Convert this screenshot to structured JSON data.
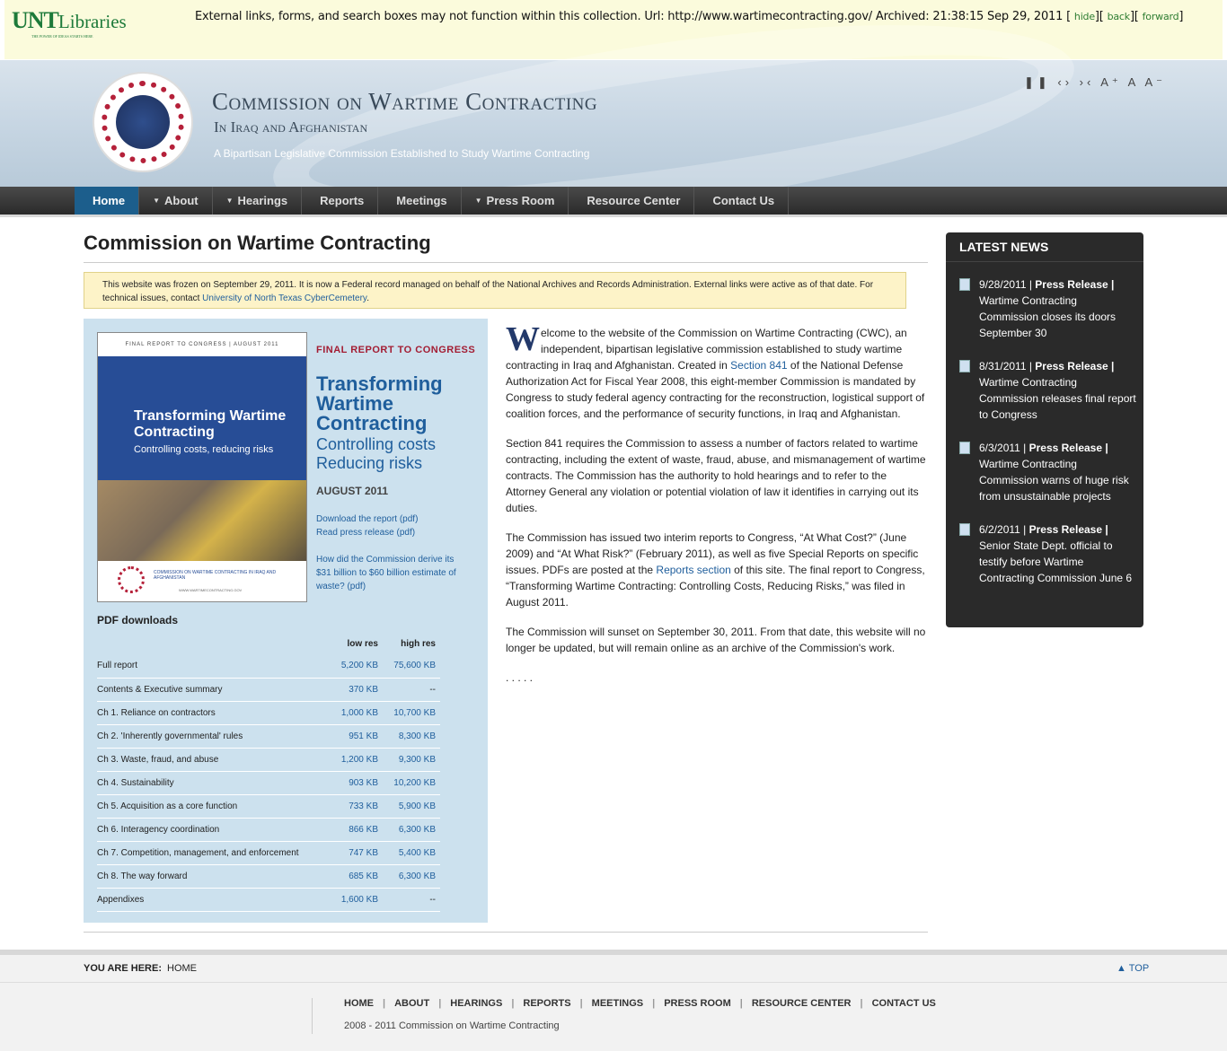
{
  "unt": {
    "logo_unt": "UNT",
    "logo_libraries": "Libraries",
    "logo_tagline": "THE POWER OF IDEAS STARTS HERE",
    "message": "External links, forms, and search boxes may not function within this collection. Url: http://www.wartimecontracting.gov/ Archived: 21:38:15 Sep 29, 2011 [",
    "hide": "hide",
    "sep1": "][",
    "back": "back",
    "sep2": "][",
    "forward": "forward",
    "end": "]"
  },
  "header": {
    "title": "Commission on Wartime Contracting",
    "subtitle": "In Iraq and Afghanistan",
    "tagline": "A Bipartisan Legislative Commission Established to Study Wartime Contracting",
    "tools": "❚❚ ‹› ›‹  A⁺ A A⁻"
  },
  "nav": [
    {
      "label": "Home",
      "caret": ""
    },
    {
      "label": "About",
      "caret": "▼"
    },
    {
      "label": "Hearings",
      "caret": "▼"
    },
    {
      "label": "Reports",
      "caret": ""
    },
    {
      "label": "Meetings",
      "caret": ""
    },
    {
      "label": "Press Room",
      "caret": "▼"
    },
    {
      "label": "Resource Center",
      "caret": ""
    },
    {
      "label": "Contact Us",
      "caret": ""
    }
  ],
  "page": {
    "title": "Commission on Wartime Contracting",
    "notice_text": "This website was frozen on September 29, 2011. It is now a Federal record managed on behalf of the National Archives and Records Administration. External links were active as of that date. For technical issues, contact ",
    "notice_link": "University of North Texas CyberCemetery",
    "notice_end": "."
  },
  "report": {
    "cover_top": "FINAL REPORT TO CONGRESS  |  AUGUST 2011",
    "cover_title": "Transforming Wartime Contracting",
    "cover_sub": "Controlling costs, reducing risks",
    "cover_footer": "COMMISSION ON WARTIME CONTRACTING IN IRAQ AND AFGHANISTAN",
    "cover_url": "WWW.WARTIMECONTRACTING.GOV",
    "label": "FINAL REPORT TO CONGRESS",
    "title": "Transforming Wartime Contracting",
    "subtitle_1": "Controlling costs",
    "subtitle_2": "Reducing risks",
    "date": "AUGUST 2011",
    "link_download": "Download the report (pdf)",
    "link_press": "Read press release (pdf)",
    "link_estimate": "How did the Commission derive its $31 billion to $60 billion estimate of waste? (pdf)"
  },
  "pdf": {
    "heading": "PDF downloads",
    "col_low": "low res",
    "col_high": "high res",
    "rows": [
      {
        "name": "Full report",
        "low": "5,200 KB",
        "high": "75,600 KB"
      },
      {
        "name": "Contents & Executive summary",
        "low": "370 KB",
        "high": "--"
      },
      {
        "name": "Ch 1. Reliance on contractors",
        "low": "1,000 KB",
        "high": "10,700 KB"
      },
      {
        "name": "Ch 2. 'Inherently governmental' rules",
        "low": "951 KB",
        "high": "8,300 KB"
      },
      {
        "name": "Ch 3. Waste, fraud, and abuse",
        "low": "1,200 KB",
        "high": "9,300 KB"
      },
      {
        "name": "Ch 4. Sustainability",
        "low": "903 KB",
        "high": "10,200 KB"
      },
      {
        "name": "Ch 5. Acquisition as a core function",
        "low": "733 KB",
        "high": "5,900 KB"
      },
      {
        "name": "Ch 6. Interagency coordination",
        "low": "866 KB",
        "high": "6,300 KB"
      },
      {
        "name": "Ch 7. Competition, management, and enforcement",
        "low": "747 KB",
        "high": "5,400 KB"
      },
      {
        "name": "Ch 8. The way forward",
        "low": "685 KB",
        "high": "6,300 KB"
      },
      {
        "name": "Appendixes",
        "low": "1,600 KB",
        "high": "--"
      }
    ]
  },
  "welcome": {
    "drop": "W",
    "p1_a": "elcome to the website of the Commission on Wartime Contracting (CWC), an independent, bipartisan legislative commission established to study wartime contracting in Iraq and Afghanistan. Created in ",
    "p1_link": "Section 841",
    "p1_b": " of the National Defense Authorization Act for Fiscal Year 2008, this eight-member Commission is mandated by Congress to study federal agency contracting for the reconstruction, logistical support of coalition forces, and the performance of security functions, in Iraq and Afghanistan.",
    "p2": "Section 841 requires the Commission to assess a number of factors related to wartime contracting, including the extent of waste, fraud, abuse, and mismanagement of wartime contracts. The Commission has the authority to hold hearings and to refer to the Attorney General any violation or potential violation of law it identifies in carrying out its duties.",
    "p3_a": "The Commission has issued two interim reports to Congress, “At What Cost?” (June 2009) and “At What Risk?” (February 2011), as well as five Special Reports on specific issues. PDFs are posted at the ",
    "p3_link": "Reports section",
    "p3_b": " of this site. The final report to Congress, “Transforming Wartime Contracting: Controlling Costs, Reducing Risks,” was filed in August 2011.",
    "p4": "The Commission will sunset on September 30, 2011. From that date, this website will no longer be updated, but will remain online as an archive of the Commission's work.",
    "dots": ". . . . ."
  },
  "news": {
    "heading": "LATEST NEWS",
    "items": [
      {
        "date": "9/28/2011 | ",
        "type": "Press Release",
        "sep": " |",
        "text": " Wartime Contracting Commission closes its doors September 30"
      },
      {
        "date": "8/31/2011 | ",
        "type": "Press Release",
        "sep": " |",
        "text": " Wartime Contracting Commission releases final report to Congress"
      },
      {
        "date": "6/3/2011 | ",
        "type": "Press Release",
        "sep": " |",
        "text": " Wartime Contracting Commission warns of huge risk from unsustainable projects"
      },
      {
        "date": "6/2/2011 | ",
        "type": "Press Release",
        "sep": " |",
        "text": " Senior State Dept. official to testify before Wartime Contracting Commission June 6"
      }
    ]
  },
  "footer": {
    "you_are_here": "YOU ARE HERE:",
    "crumb": "HOME",
    "top": "▲ TOP",
    "nav": [
      "HOME",
      "ABOUT",
      "HEARINGS",
      "REPORTS",
      "MEETINGS",
      "PRESS ROOM",
      "RESOURCE CENTER",
      "CONTACT US"
    ],
    "sep": "|",
    "copyright": "2008 - 2011 Commission on Wartime Contracting"
  }
}
